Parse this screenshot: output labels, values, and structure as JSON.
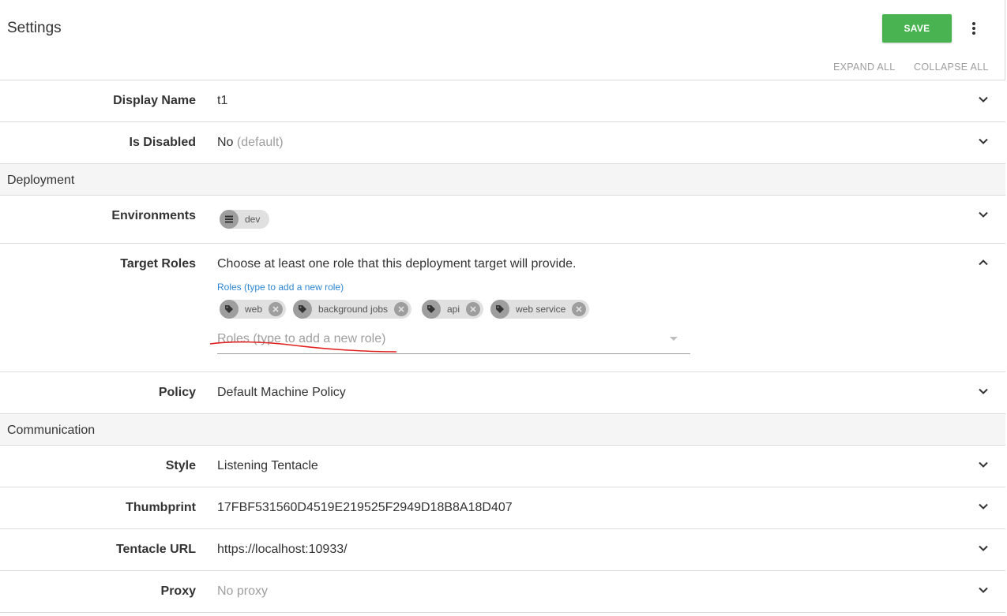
{
  "header": {
    "title": "Settings",
    "save_label": "SAVE",
    "expand_all": "EXPAND ALL",
    "collapse_all": "COLLAPSE ALL"
  },
  "fields": {
    "display_name": {
      "label": "Display Name",
      "value": "t1"
    },
    "is_disabled": {
      "label": "Is Disabled",
      "value": "No",
      "suffix": "(default)"
    },
    "environments": {
      "label": "Environments",
      "chips": [
        "dev"
      ]
    },
    "target_roles": {
      "label": "Target Roles",
      "description": "Choose at least one role that this deployment target will provide.",
      "hint": "Roles (type to add a new role)",
      "chips": [
        "web",
        "background jobs",
        "api",
        "web service"
      ],
      "placeholder": "Roles (type to add a new role)"
    },
    "policy": {
      "label": "Policy",
      "value": "Default Machine Policy"
    },
    "style": {
      "label": "Style",
      "value": "Listening Tentacle"
    },
    "thumbprint": {
      "label": "Thumbprint",
      "value": "17FBF531560D4519E219525F2949D18B8A18D407"
    },
    "tentacle_url": {
      "label": "Tentacle URL",
      "value": "https://localhost:10933/"
    },
    "proxy": {
      "label": "Proxy",
      "value": "No proxy"
    }
  },
  "sections": {
    "deployment": "Deployment",
    "communication": "Communication"
  },
  "colors": {
    "save_button": "#48b350",
    "hint_link": "#2f86d1",
    "annotation": "#e0201c"
  },
  "icons": {
    "more": "more-vert-icon",
    "expand": "chevron-down-icon",
    "collapse": "chevron-up-icon",
    "environment": "list-icon",
    "role": "tag-icon",
    "remove": "close-circle-icon"
  }
}
